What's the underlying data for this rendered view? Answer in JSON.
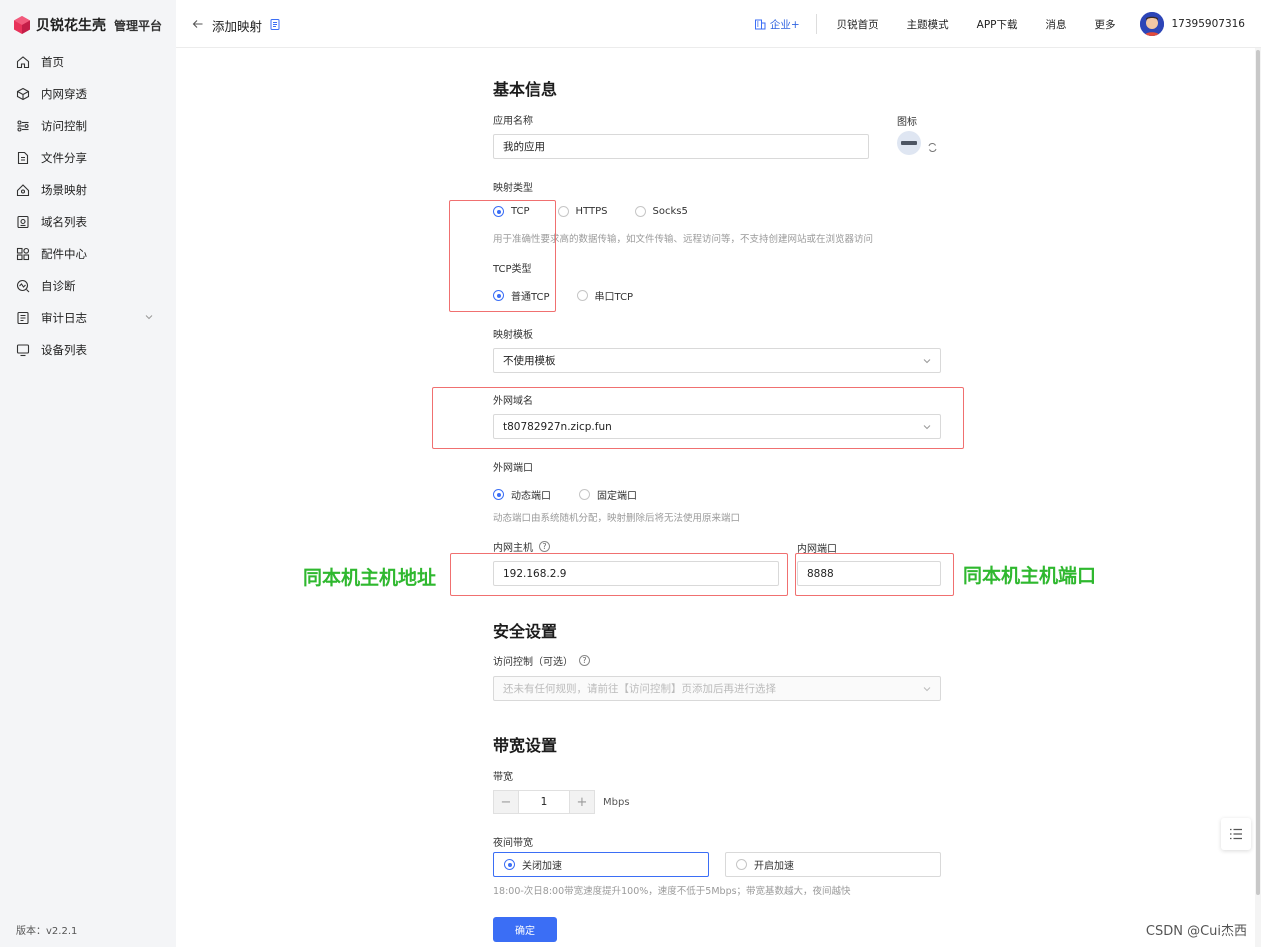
{
  "app": {
    "brand": "贝锐花生壳",
    "subtitle": "管理平台",
    "version": "版本：v2.2.1"
  },
  "sidebar": {
    "items": [
      {
        "label": "首页",
        "icon": "home-icon"
      },
      {
        "label": "内网穿透",
        "icon": "cube-icon"
      },
      {
        "label": "访问控制",
        "icon": "sliders-icon"
      },
      {
        "label": "文件分享",
        "icon": "file-share-icon"
      },
      {
        "label": "场景映射",
        "icon": "scene-icon"
      },
      {
        "label": "域名列表",
        "icon": "domain-list-icon"
      },
      {
        "label": "配件中心",
        "icon": "grid-icon"
      },
      {
        "label": "自诊断",
        "icon": "diagnose-icon"
      },
      {
        "label": "审计日志",
        "icon": "log-icon"
      },
      {
        "label": "设备列表",
        "icon": "monitor-icon"
      }
    ]
  },
  "header": {
    "title": "添加映射",
    "nav": [
      "企业+",
      "贝锐首页",
      "主题模式",
      "APP下载",
      "消息",
      "更多"
    ],
    "phone": "17395907316"
  },
  "form": {
    "basic_title": "基本信息",
    "app_name_label": "应用名称",
    "app_name_value": "我的应用",
    "icon_label": "图标",
    "map_type_label": "映射类型",
    "map_types": [
      "TCP",
      "HTTPS",
      "Socks5"
    ],
    "map_type_hint": "用于准确性要求高的数据传输，如文件传输、远程访问等，不支持创建网站或在浏览器访问",
    "tcp_type_label": "TCP类型",
    "tcp_types": [
      "普通TCP",
      "串口TCP"
    ],
    "template_label": "映射模板",
    "template_value": "不使用模板",
    "domain_label": "外网域名",
    "domain_value": "t80782927n.zicp.fun",
    "port_label": "外网端口",
    "port_types": [
      "动态端口",
      "固定端口"
    ],
    "port_hint": "动态端口由系统随机分配，映射删除后将无法使用原来端口",
    "host_label": "内网主机",
    "host_value": "192.168.2.9",
    "lan_port_label": "内网端口",
    "lan_port_value": "8888",
    "security_title": "安全设置",
    "access_label": "访问控制（可选）",
    "access_placeholder": "还未有任何规则，请前往【访问控制】页添加后再进行选择",
    "bandwidth_title": "带宽设置",
    "bandwidth_label": "带宽",
    "bandwidth_value": "1",
    "bandwidth_unit": "Mbps",
    "night_label": "夜间带宽",
    "night_options": [
      "关闭加速",
      "开启加速"
    ],
    "night_hint": "18:00-次日8:00带宽速度提升100%，速度不低于5Mbps；带宽基数越大，夜间越快",
    "submit": "确定"
  },
  "annotations": {
    "host_note": "同本机主机地址",
    "port_note": "同本机主机端口"
  },
  "watermark": "CSDN @Cui杰西",
  "colors": {
    "primary": "#3b6ef5",
    "annotation_box": "#f07070",
    "annotation_text": "#2fb82f"
  }
}
